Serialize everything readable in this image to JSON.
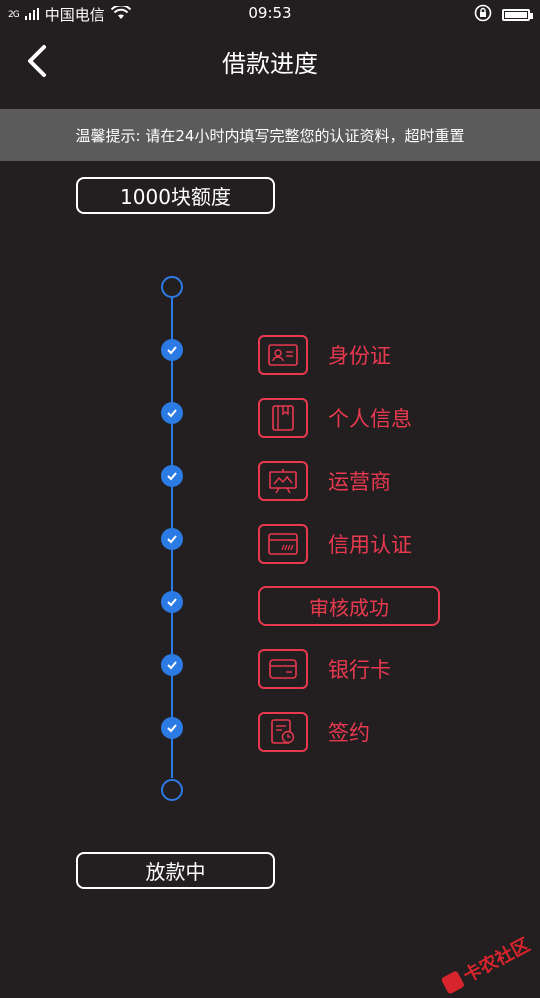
{
  "status_bar": {
    "network": "2G",
    "carrier": "中国电信",
    "time": "09:53"
  },
  "nav": {
    "title": "借款进度"
  },
  "notice": {
    "text": "温馨提示: 请在24小时内填写完整您的认证资料，超时重置"
  },
  "quota_badge": "1000块额度",
  "steps": [
    {
      "label": "身份证",
      "icon": "id-card-icon"
    },
    {
      "label": "个人信息",
      "icon": "personal-info-icon"
    },
    {
      "label": "运营商",
      "icon": "carrier-icon"
    },
    {
      "label": "信用认证",
      "icon": "credit-icon"
    },
    {
      "label": "审核成功",
      "icon": ""
    },
    {
      "label": "银行卡",
      "icon": "bank-card-icon"
    },
    {
      "label": "签约",
      "icon": "sign-contract-icon"
    }
  ],
  "final_badge": "放款中",
  "watermark": "卡农社区",
  "colors": {
    "background": "#231f20",
    "accent_red": "#e8394f",
    "timeline_blue": "#2c7be5",
    "notice_bg": "#5b5b5b"
  }
}
